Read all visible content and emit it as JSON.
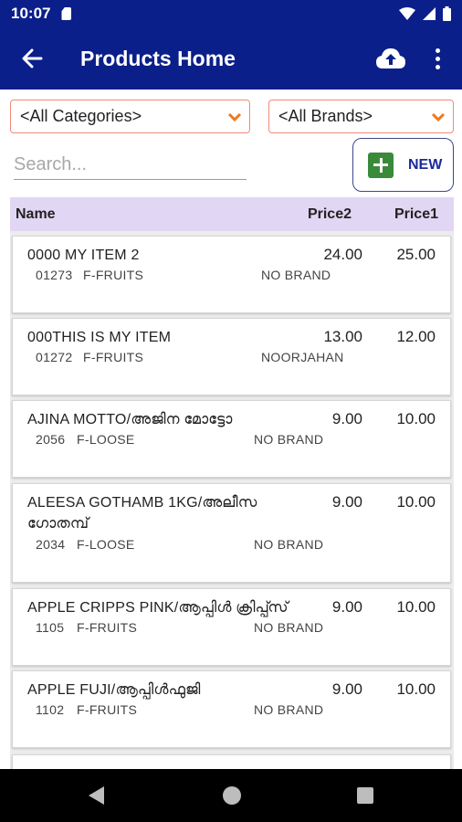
{
  "status_bar": {
    "time": "10:07"
  },
  "app_bar": {
    "title": "Products Home"
  },
  "filters": {
    "category_value": "<All Categories>",
    "brand_value": "<All Brands>"
  },
  "search": {
    "placeholder": "Search..."
  },
  "new_button": {
    "label": "NEW"
  },
  "table_header": {
    "name": "Name",
    "price2": "Price2",
    "price1": "Price1"
  },
  "items": [
    {
      "name": "0000 MY ITEM 2",
      "code": "01273",
      "category": "F-FRUITS",
      "brand": "NO BRAND",
      "price2": "24.00",
      "price1": "25.00"
    },
    {
      "name": "000THIS IS MY ITEM",
      "code": "01272",
      "category": "F-FRUITS",
      "brand": "NOORJAHAN",
      "price2": "13.00",
      "price1": "12.00"
    },
    {
      "name": "AJINA MOTTO/അജിന മോട്ടോ",
      "code": "2056",
      "category": "F-LOOSE",
      "brand": "NO BRAND",
      "price2": "9.00",
      "price1": "10.00"
    },
    {
      "name": "ALEESA GOTHAMB 1KG/അലീസ ഗോതമ്പ്",
      "code": "2034",
      "category": "F-LOOSE",
      "brand": "NO BRAND",
      "price2": "9.00",
      "price1": "10.00"
    },
    {
      "name": "APPLE CRIPPS PINK/ആപ്പിൾ ക്രിപ്പ്സ്",
      "code": "1105",
      "category": "F-FRUITS",
      "brand": "NO BRAND",
      "price2": "9.00",
      "price1": "10.00"
    },
    {
      "name": "APPLE FUJI/ആപ്പിൾഫുജി",
      "code": "1102",
      "category": "F-FRUITS",
      "brand": "NO BRAND",
      "price2": "9.00",
      "price1": "10.00"
    }
  ],
  "colors": {
    "app_bar": "#0b1f8a",
    "header_row": "#e1d6f3",
    "select_border": "#f08a7a",
    "select_chevron": "#f07a1a",
    "new_icon": "#3a8a3a",
    "new_label": "#1a2a9a"
  },
  "icons": {
    "back": "arrow-left-icon",
    "upload": "cloud-upload-icon",
    "more": "more-vert-icon",
    "add": "plus-square-icon",
    "dropdown": "chevron-down-icon"
  }
}
